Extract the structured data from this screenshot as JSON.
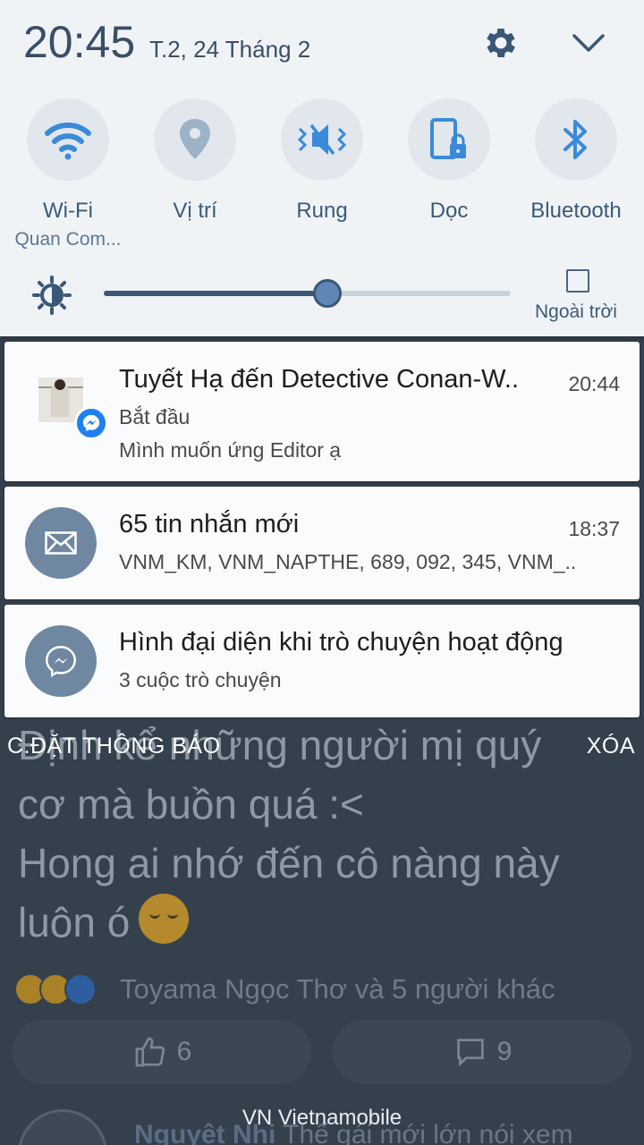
{
  "status": {
    "time": "20:45",
    "date": "T.2, 24 Tháng 2"
  },
  "quick_settings": {
    "tiles": [
      {
        "icon": "wifi-icon",
        "label": "Wi-Fi",
        "sub": "Quan Com..."
      },
      {
        "icon": "location-icon",
        "label": "Vị trí",
        "sub": ""
      },
      {
        "icon": "vibrate-icon",
        "label": "Rung",
        "sub": ""
      },
      {
        "icon": "portrait-lock-icon",
        "label": "Dọc",
        "sub": ""
      },
      {
        "icon": "bluetooth-icon",
        "label": "Bluetooth",
        "sub": ""
      }
    ],
    "brightness_level": 0.55,
    "outdoor_label": "Ngoài trời"
  },
  "notifications": [
    {
      "app_icon": "messenger-icon",
      "title": "Tuyết Hạ đến Detective Conan-W..",
      "time": "20:44",
      "line1": "Bắt đầu",
      "line2": "Mình muốn ứng Editor ạ"
    },
    {
      "app_icon": "mail-icon",
      "title": "65 tin nhắn mới",
      "time": "18:37",
      "line1": "VNM_KM, VNM_NAPTHE, 689, 092, 345, VNM_.."
    },
    {
      "app_icon": "messenger-icon",
      "title": "Hình đại diện khi trò chuyện hoạt động",
      "line1": "3 cuộc trò chuyện"
    }
  ],
  "panel_actions": {
    "settings_label": "C.ĐẶT THÔNG BÁO",
    "clear_label": "XÓA"
  },
  "background_feed": {
    "post_lines": [
      "Định kể những người mị quý",
      "cơ mà buồn quá :<",
      "Hong ai nhớ đến cô nàng này",
      "luôn ó"
    ],
    "reactors": "Toyama Ngọc Thơ và 5 người khác",
    "like_count": "6",
    "comment_count": "9",
    "comment_author": "Nguyệt Nhi",
    "comment_text": "Thế gái mới lớn nói xem"
  },
  "carrier": "VN Vietnamobile",
  "colors": {
    "panel_bg": "#f0f3f6",
    "accent": "#3b5778",
    "tile_icon": "#3b8ad9",
    "messenger": "#1d7ff2"
  }
}
